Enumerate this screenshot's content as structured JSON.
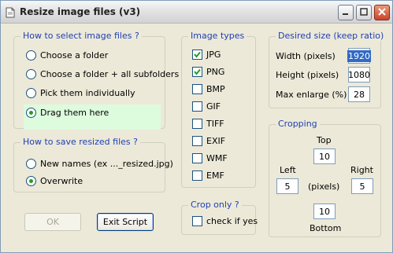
{
  "window": {
    "title": "Resize image files (v3)"
  },
  "select_group": {
    "legend": "How to select image files ?",
    "options": [
      "Choose a folder",
      "Choose a folder + all subfolders",
      "Pick them individually",
      "Drag them here"
    ],
    "selected": "Drag them here"
  },
  "save_group": {
    "legend": "How to save resized files ?",
    "options": [
      "New names (ex ..._resized.jpg)",
      "Overwrite"
    ],
    "selected": "Overwrite"
  },
  "types_group": {
    "legend": "Image types",
    "items": [
      {
        "label": "JPG",
        "checked": true
      },
      {
        "label": "PNG",
        "checked": true
      },
      {
        "label": "BMP",
        "checked": false
      },
      {
        "label": "GIF",
        "checked": false
      },
      {
        "label": "TIFF",
        "checked": false
      },
      {
        "label": "EXIF",
        "checked": false
      },
      {
        "label": "WMF",
        "checked": false
      },
      {
        "label": "EMF",
        "checked": false
      }
    ]
  },
  "crop_only_group": {
    "legend": "Crop only ?",
    "check_label": "check if yes",
    "checked": false
  },
  "size_group": {
    "legend": "Desired size (keep ratio)",
    "width_label": "Width (pixels)",
    "width_value": "1920",
    "height_label": "Height (pixels)",
    "height_value": "1080",
    "enlarge_label": "Max enlarge (%)",
    "enlarge_value": "28"
  },
  "crop_group": {
    "legend": "Cropping",
    "top_label": "Top",
    "top_value": "10",
    "left_label": "Left",
    "left_value": "5",
    "right_label": "Right",
    "right_value": "5",
    "unit_label": "(pixels)",
    "bottom_label": "Bottom",
    "bottom_value": "10"
  },
  "buttons": {
    "ok": "OK",
    "exit": "Exit Script"
  },
  "colors": {
    "legend": "#1f3fb6",
    "highlight": "#ddfcdd",
    "radio_dot": "#21a121",
    "check_mark": "#21a121"
  }
}
